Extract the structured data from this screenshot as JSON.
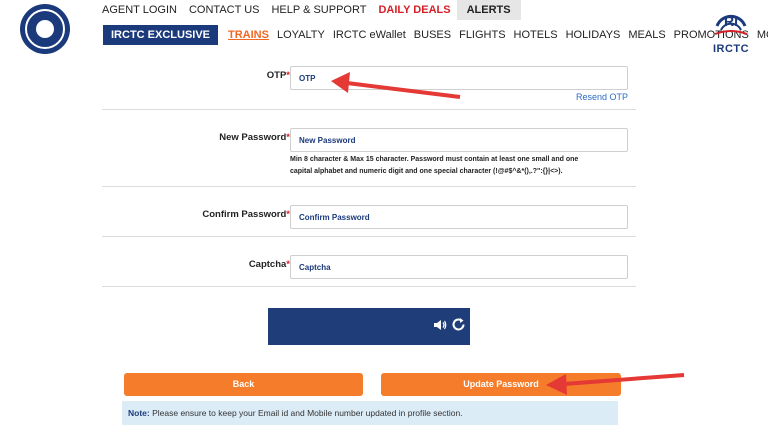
{
  "header": {
    "logo_right_text": "IRCTC",
    "top_links": [
      "AGENT LOGIN",
      "CONTACT US",
      "HELP & SUPPORT",
      "DAILY DEALS",
      "ALERTS"
    ],
    "exclusive_label": "IRCTC EXCLUSIVE",
    "main_links": [
      "TRAINS",
      "LOYALTY",
      "IRCTC eWallet",
      "BUSES",
      "FLIGHTS",
      "HOTELS",
      "HOLIDAYS",
      "MEALS",
      "PROMOTIONS",
      "MORE"
    ]
  },
  "form": {
    "otp": {
      "label": "OTP",
      "placeholder": "OTP",
      "resend": "Resend OTP"
    },
    "new_password": {
      "label": "New Password",
      "placeholder": "New Password",
      "hint_line1": "Min 8 character & Max 15 character. Password must contain at least one small and one",
      "hint_line2": "capital alphabet and numeric digit and one special character (!@#$^&*(),.?\":{}|<>)."
    },
    "confirm_password": {
      "label": "Confirm Password",
      "placeholder": "Confirm Password"
    },
    "captcha": {
      "label": "Captcha",
      "placeholder": "Captcha"
    },
    "required_mark": "*"
  },
  "buttons": {
    "back": "Back",
    "update": "Update Password"
  },
  "note": {
    "bold": "Note:",
    "text": " Please ensure to keep your Email id and Mobile number updated in profile section."
  },
  "colors": {
    "brand_blue": "#1b3a7c",
    "accent_orange": "#f47c2a",
    "deals_red": "#d61f26",
    "arrow_red": "#e53935"
  }
}
